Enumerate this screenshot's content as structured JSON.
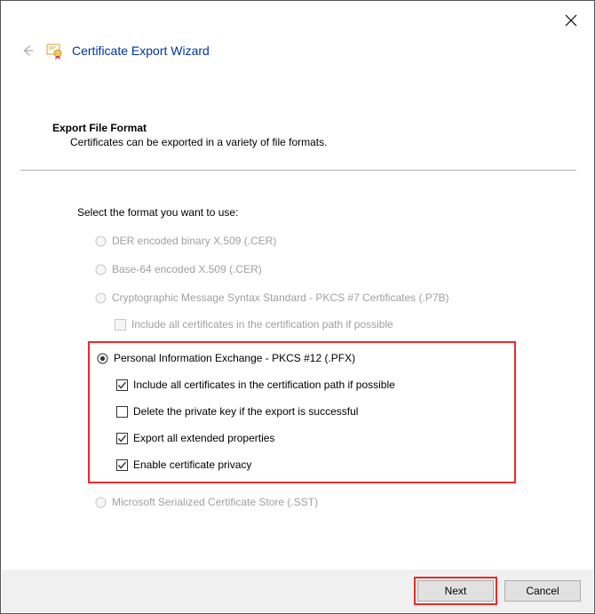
{
  "header": {
    "title": "Certificate Export Wizard"
  },
  "section": {
    "title": "Export File Format",
    "subtitle": "Certificates can be exported in a variety of file formats."
  },
  "instruction": "Select the format you want to use:",
  "options": {
    "der": "DER encoded binary X.509 (.CER)",
    "base64": "Base-64 encoded X.509 (.CER)",
    "pkcs7": "Cryptographic Message Syntax Standard - PKCS #7 Certificates (.P7B)",
    "pkcs7_include": "Include all certificates in the certification path if possible",
    "pfx": "Personal Information Exchange - PKCS #12 (.PFX)",
    "pfx_include": "Include all certificates in the certification path if possible",
    "pfx_delete": "Delete the private key if the export is successful",
    "pfx_extended": "Export all extended properties",
    "pfx_privacy": "Enable certificate privacy",
    "sst": "Microsoft Serialized Certificate Store (.SST)"
  },
  "footer": {
    "next": "Next",
    "cancel": "Cancel"
  }
}
